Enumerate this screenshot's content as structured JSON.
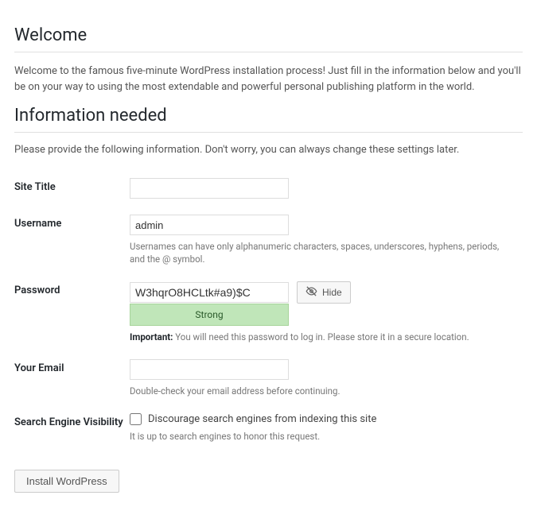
{
  "welcome": {
    "heading": "Welcome",
    "intro": "Welcome to the famous five-minute WordPress installation process! Just fill in the information below and you'll be on your way to using the most extendable and powerful personal publishing platform in the world."
  },
  "info": {
    "heading": "Information needed",
    "hint": "Please provide the following information. Don't worry, you can always change these settings later."
  },
  "fields": {
    "site_title": {
      "label": "Site Title",
      "value": ""
    },
    "username": {
      "label": "Username",
      "value": "admin",
      "desc": "Usernames can have only alphanumeric characters, spaces, underscores, hyphens, periods, and the @ symbol."
    },
    "password": {
      "label": "Password",
      "value": "W3hqrO8HCLtk#a9)$C",
      "hide_label": "Hide",
      "strength": "Strong",
      "important_prefix": "Important:",
      "important_rest": " You will need this password to log in. Please store it in a secure location."
    },
    "email": {
      "label": "Your Email",
      "value": "",
      "desc": "Double-check your email address before continuing."
    },
    "search": {
      "label": "Search Engine Visibility",
      "checkbox_label": "Discourage search engines from indexing this site",
      "desc": "It is up to search engines to honor this request.",
      "checked": false
    }
  },
  "submit_label": "Install WordPress"
}
